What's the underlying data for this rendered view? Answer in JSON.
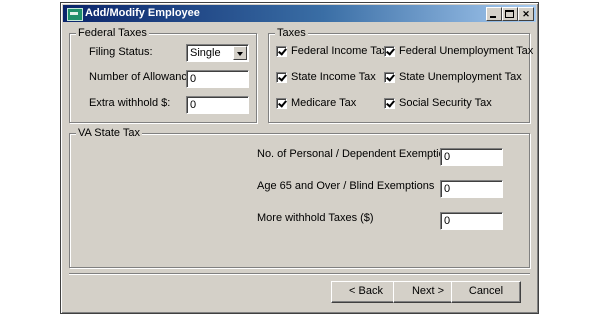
{
  "window": {
    "title": "Add/Modify Employee"
  },
  "federal": {
    "legend": "Federal Taxes",
    "filing_status_label": "Filing Status:",
    "filing_status_value": "Single",
    "allowance_label": "Number of Allowance:",
    "allowance_value": "0",
    "extra_label": "Extra withhold $:",
    "extra_value": "0"
  },
  "taxes": {
    "legend": "Taxes",
    "items": [
      {
        "label": "Federal Income Tax",
        "checked": true
      },
      {
        "label": "Federal Unemployment Tax",
        "checked": true
      },
      {
        "label": "State Income Tax",
        "checked": true
      },
      {
        "label": "State Unemployment Tax",
        "checked": true
      },
      {
        "label": "Medicare Tax",
        "checked": true
      },
      {
        "label": "Social Security Tax",
        "checked": true
      }
    ]
  },
  "state": {
    "legend": "VA State Tax",
    "exemptions_label": "No. of Personal / Dependent Exemptions",
    "exemptions_value": "0",
    "age_label": "Age 65 and Over / Blind Exemptions",
    "age_value": "0",
    "more_label": "More withhold Taxes ($)",
    "more_value": "0"
  },
  "buttons": {
    "back": "< Back",
    "next": "Next >",
    "cancel": "Cancel"
  }
}
